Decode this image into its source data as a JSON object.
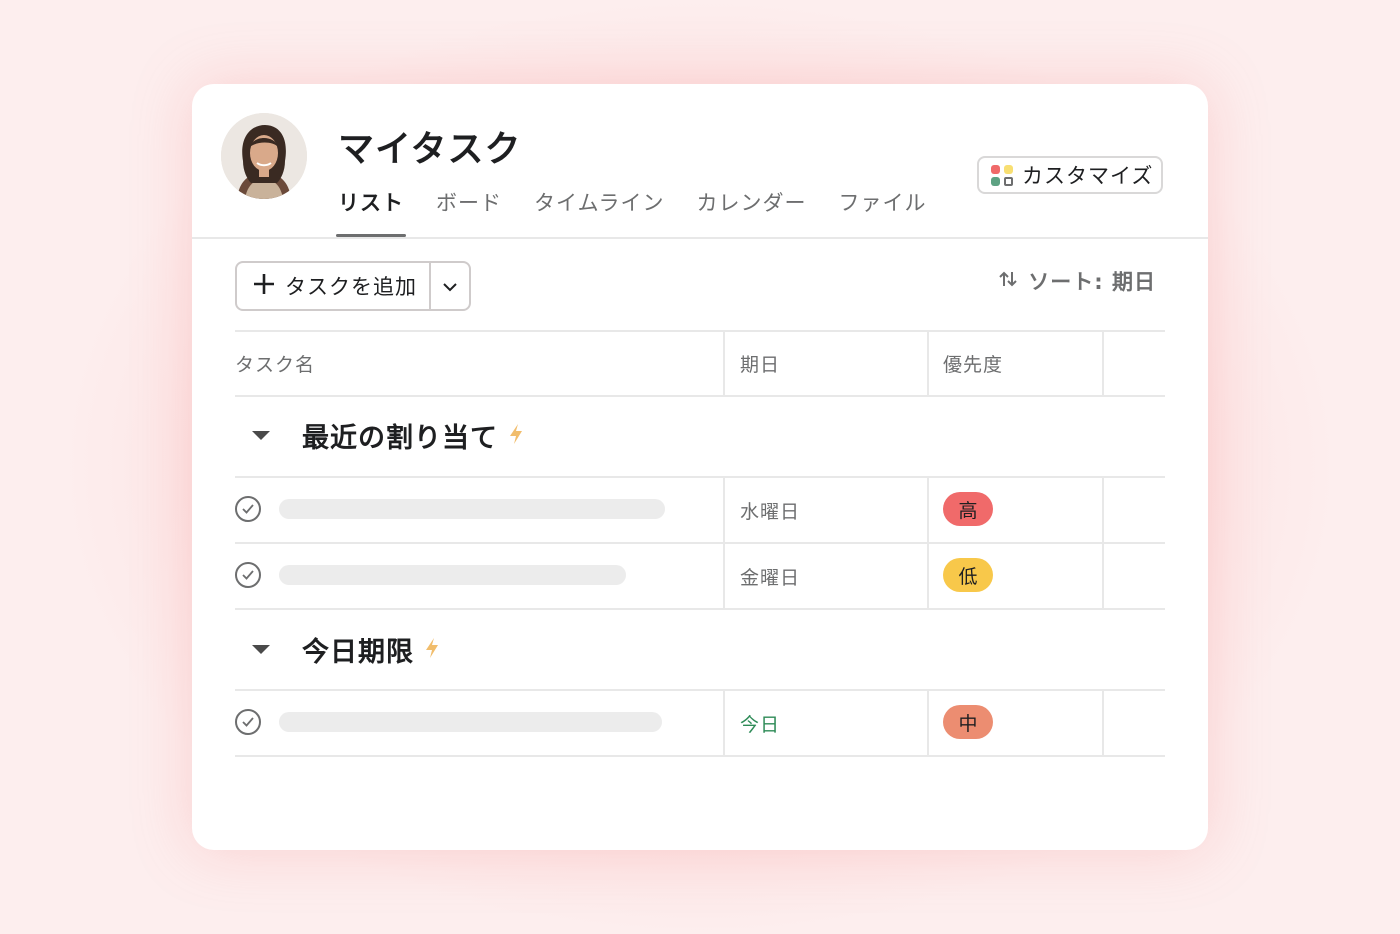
{
  "page": {
    "title": "マイタスク"
  },
  "tabs": [
    {
      "label": "リスト"
    },
    {
      "label": "ボード"
    },
    {
      "label": "タイムライン"
    },
    {
      "label": "カレンダー"
    },
    {
      "label": "ファイル"
    }
  ],
  "toolbar": {
    "customize_label": "カスタマイズ",
    "add_task_label": "タスクを追加",
    "sort_label": "ソート: 期日"
  },
  "table": {
    "columns": [
      "タスク名",
      "期日",
      "優先度"
    ],
    "sections": [
      {
        "title": "最近の割り当て",
        "rows": [
          {
            "due": "水曜日",
            "priority": "高"
          },
          {
            "due": "金曜日",
            "priority": "低"
          }
        ]
      },
      {
        "title": "今日期限",
        "rows": [
          {
            "due": "今日",
            "priority": "中"
          }
        ]
      }
    ]
  },
  "colors": {
    "background": "#fde6e6",
    "priority_high": "#f06a6a",
    "priority_low": "#f8c84a",
    "priority_medium": "#ec8d71",
    "due_today": "#2e8b57",
    "bolt": "#f1bd6c",
    "customize_icon": [
      "#f06a6a",
      "#f8df72",
      "#5da283",
      "#6d6e6f"
    ]
  },
  "icons": {
    "customize": "grid-icon",
    "add": "plus-icon",
    "dropdown": "chevron-down-icon",
    "sort": "sort-arrows-icon",
    "section_toggle": "caret-down-icon",
    "section_badge": "lightning-bolt-icon",
    "task_complete": "check-circle-icon"
  }
}
